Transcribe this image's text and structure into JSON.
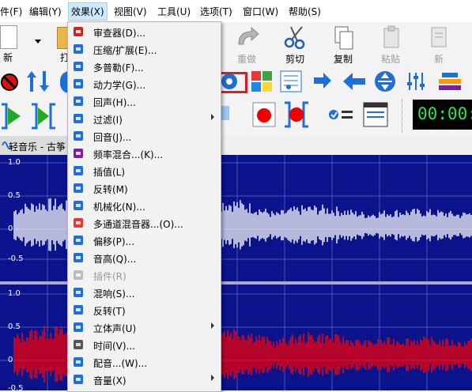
{
  "menubar": {
    "items": [
      {
        "label": "件(F)"
      },
      {
        "label": "编辑(Y)"
      },
      {
        "label": "效果(X)"
      },
      {
        "label": "视图(V)"
      },
      {
        "label": "工具(U)"
      },
      {
        "label": "选项(T)"
      },
      {
        "label": "窗口(W)"
      },
      {
        "label": "帮助(S)"
      }
    ]
  },
  "toolbar": {
    "new_label": "新",
    "open_label": "打",
    "redo_label": "重做",
    "cut_label": "剪切",
    "copy_label": "复制",
    "paste_label": "粘贴",
    "new2_label": "新"
  },
  "timer": {
    "value": "00:00:"
  },
  "track": {
    "title": "轻音乐 - 古筝"
  },
  "waveform": {
    "channel1_labels": [
      "1.0",
      "0.5",
      "0",
      "-0.5"
    ],
    "channel2_labels": [
      "1.0",
      "0.5",
      "0",
      "-0.5"
    ],
    "colors": {
      "background": "#0a128c",
      "channel1": "#ffffff",
      "channel2": "#ff0000"
    }
  },
  "effects_menu": {
    "items": [
      {
        "label": "审查器(D)...",
        "icon": "inspector-icon"
      },
      {
        "label": "压缩/扩展(E)...",
        "icon": "compress-icon"
      },
      {
        "label": "多普勒(F)...",
        "icon": "doppler-icon"
      },
      {
        "label": "动力学(G)...",
        "icon": "dynamics-icon",
        "highlighted": true
      },
      {
        "label": "回声(H)...",
        "icon": "echo-icon"
      },
      {
        "label": "过滤(I)",
        "icon": "filter-icon",
        "submenu": true
      },
      {
        "label": "回音(J)...",
        "icon": "reverb-echo-icon"
      },
      {
        "label": "频率混合...(K)...",
        "icon": "freq-mix-icon"
      },
      {
        "label": "插值(L)",
        "icon": "interpolate-icon"
      },
      {
        "label": "反转(M)",
        "icon": "reverse-icon"
      },
      {
        "label": "机械化(N)...",
        "icon": "mechanize-icon"
      },
      {
        "label": "多通道混音器...(O)...",
        "icon": "multichannel-mixer-icon"
      },
      {
        "label": "偏移(P)...",
        "icon": "offset-icon"
      },
      {
        "label": "音高(Q)...",
        "icon": "pitch-icon"
      },
      {
        "label": "插件(R)",
        "icon": "plugin-icon",
        "disabled": true
      },
      {
        "label": "混响(S)...",
        "icon": "reverb-icon"
      },
      {
        "label": "反转(T)",
        "icon": "invert-icon"
      },
      {
        "label": "立体声(U)",
        "icon": "stereo-icon",
        "submenu": true
      },
      {
        "label": "时间(V)...",
        "icon": "clock-icon"
      },
      {
        "label": "配音...(W)...",
        "icon": "dub-icon"
      },
      {
        "label": "音量(X)",
        "icon": "volume-icon",
        "submenu": true
      }
    ]
  }
}
